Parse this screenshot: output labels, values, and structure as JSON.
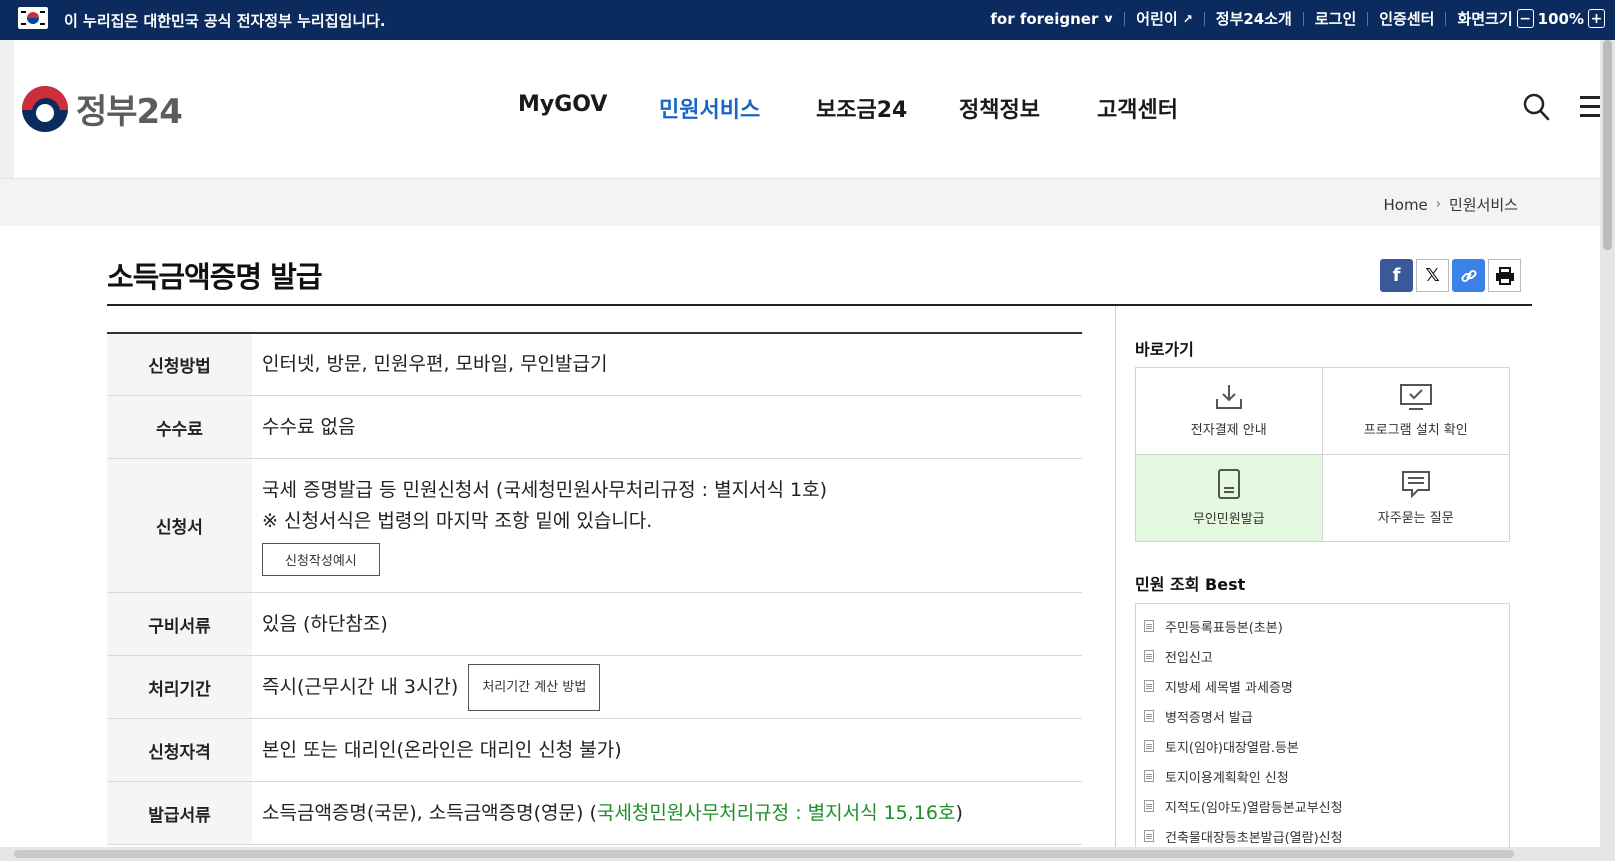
{
  "gov_bar": {
    "notice": "이 누리집은 대한민국 공식 전자정부 누리집입니다.",
    "for_foreigner": "for foreigner",
    "kids": "어린이",
    "about": "정부24소개",
    "login": "로그인",
    "cert_center": "인증센터",
    "screen_size": "화면크기",
    "zoom_out": "−",
    "zoom_level": "100%",
    "zoom_in": "+"
  },
  "header": {
    "logo_text": "정부24",
    "nav": [
      "MyGOV",
      "민원서비스",
      "보조금24",
      "정책정보",
      "고객센터"
    ],
    "active_nav": "민원서비스"
  },
  "breadcrumb": {
    "home": "Home",
    "current": "민원서비스"
  },
  "page": {
    "title": "소득금액증명 발급"
  },
  "info_table": [
    {
      "label": "신청방법",
      "lines": [
        "인터넷, 방문, 민원우편, 모바일, 무인발급기"
      ]
    },
    {
      "label": "수수료",
      "lines": [
        "수수료 없음"
      ]
    },
    {
      "label": "신청서",
      "lines": [
        "국세 증명발급 등 민원신청서 (국세청민원사무처리규정 : 별지서식 1호)",
        "※ 신청서식은 법령의 마지막 조항 밑에 있습니다."
      ],
      "button": "신청작성예시"
    },
    {
      "label": "구비서류",
      "lines": [
        "있음 (하단참조)"
      ]
    },
    {
      "label": "처리기간",
      "lines": [
        "즉시(근무시간 내 3시간)"
      ],
      "button": "처리기간 계산 방법"
    },
    {
      "label": "신청자격",
      "lines": [
        "본인 또는 대리인(온라인은 대리인 신청 불가)"
      ]
    },
    {
      "label": "발급서류",
      "lines": [
        "소득금액증명(국문), 소득금액증명(영문) ("
      ],
      "link": "국세청민원사무처리규정 : 별지서식 15,16호",
      "suffix": ")"
    }
  ],
  "quick_links": {
    "title": "바로가기",
    "items": [
      {
        "label": "전자결제 안내",
        "icon": "download-icon"
      },
      {
        "label": "프로그램 설치 확인",
        "icon": "monitor-check-icon"
      },
      {
        "label": "무인민원발급",
        "icon": "kiosk-icon"
      },
      {
        "label": "자주묻는 질문",
        "icon": "speech-bubble-icon"
      }
    ]
  },
  "best": {
    "title": "민원 조회 Best",
    "items": [
      "주민등록표등본(초본)",
      "전입신고",
      "지방세 세목별 과세증명",
      "병적증명서 발급",
      "토지(임야)대장열람.등본",
      "토지이용계획확인 신청",
      "지적도(임야도)열람등본교부신청",
      "건축물대장등초본발급(열람)신청"
    ]
  },
  "colors": {
    "gov_bar": "#0b2a5e",
    "active_nav": "#1a66c7",
    "highlight_cell": "#e3f8df",
    "link_green": "#1e8f29"
  }
}
